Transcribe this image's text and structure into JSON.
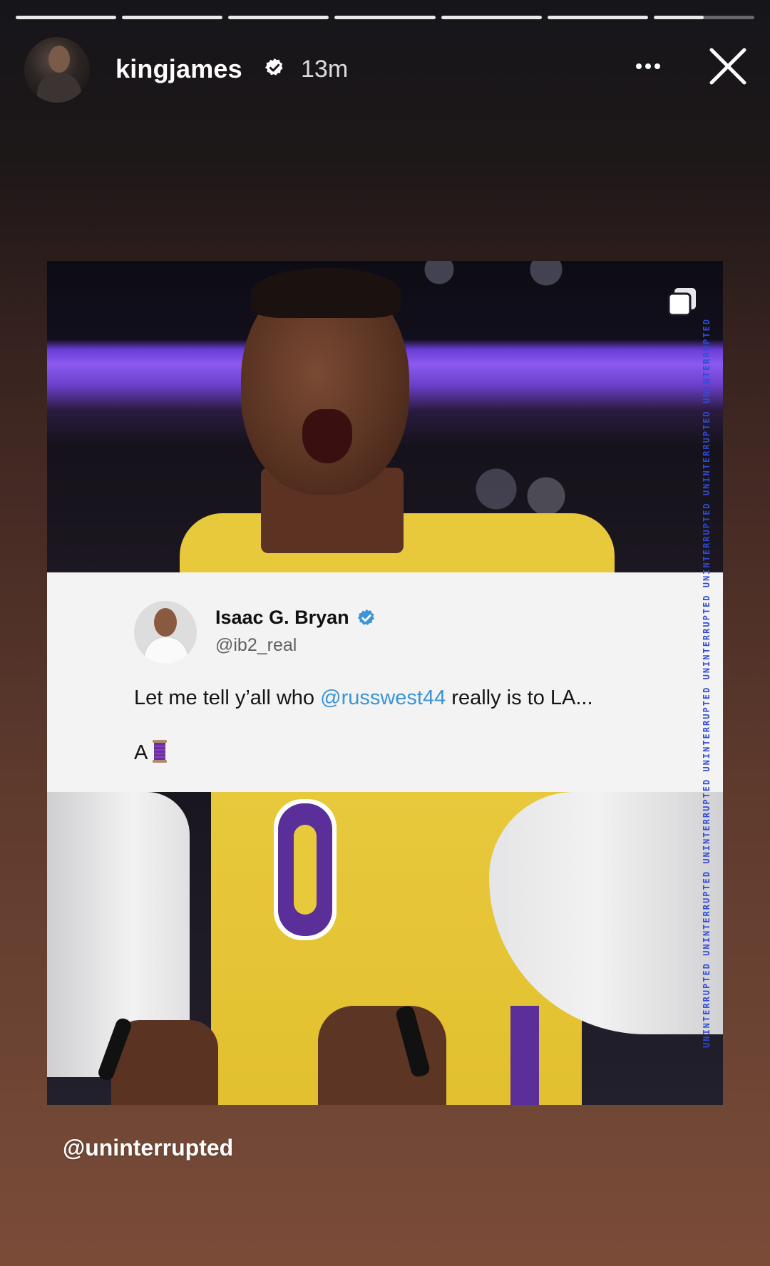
{
  "story": {
    "segments": [
      1,
      1,
      1,
      1,
      1,
      1,
      0.5
    ],
    "header": {
      "username": "kingjames",
      "time": "13m"
    },
    "post": {
      "tweet": {
        "name": "Isaac G. Bryan",
        "handle": "@ib2_real",
        "text_before": "Let me tell y’all who ",
        "mention": "@russwest44",
        "text_after": " really is to LA...",
        "line2": "A"
      },
      "watermark": "UNINTERRUPTED UNINTERRUPTED UNINTERRUPTED UNINTERRUPTED UNINTERRUPTED UNINTERRUPTED UNINTERRUPTED UNINTERRUPTED",
      "jersey_number": "0"
    },
    "mention_sticker": "@uninterrupted"
  },
  "colors": {
    "accent_blue": "#3b95d6",
    "lakers_gold": "#e8c93c",
    "lakers_purple": "#5a2f9a"
  },
  "icons": {
    "verified": "verified-badge-icon",
    "more": "more-options-icon",
    "close": "close-icon",
    "multi": "multiple-posts-icon",
    "thread": "thread-spool-icon"
  }
}
